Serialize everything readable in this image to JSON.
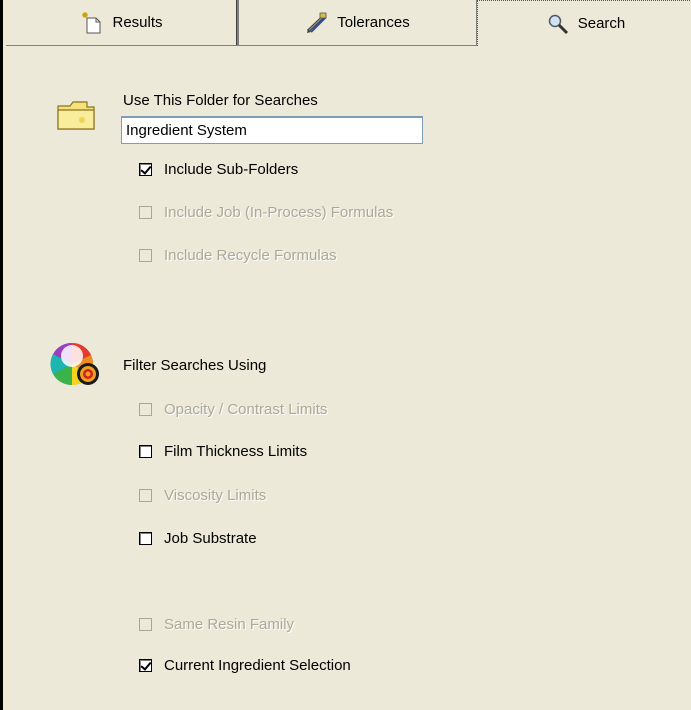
{
  "tabs": [
    {
      "label": "Results",
      "icon": "new-document-icon"
    },
    {
      "label": "Tolerances",
      "icon": "tolerances-icon"
    },
    {
      "label": "Search",
      "icon": "magnifier-icon",
      "active": true
    }
  ],
  "folder_section": {
    "title": "Use This Folder for Searches",
    "icon": "folder-icon",
    "folder_value": "Ingredient System",
    "options": [
      {
        "label": "Include Sub-Folders",
        "checked": true,
        "enabled": true
      },
      {
        "label": "Include Job (In-Process) Formulas",
        "checked": false,
        "enabled": false
      },
      {
        "label": "Include Recycle Formulas",
        "checked": false,
        "enabled": false
      }
    ]
  },
  "filter_section": {
    "title": "Filter Searches Using",
    "icon": "color-wheel-target-icon",
    "options": [
      {
        "label": "Opacity / Contrast Limits",
        "checked": false,
        "enabled": false
      },
      {
        "label": "Film Thickness Limits",
        "checked": false,
        "enabled": true
      },
      {
        "label": "Viscosity Limits",
        "checked": false,
        "enabled": false
      },
      {
        "label": "Job Substrate",
        "checked": false,
        "enabled": true
      },
      {
        "label": "Same Resin Family",
        "checked": false,
        "enabled": false
      },
      {
        "label": "Current Ingredient Selection",
        "checked": true,
        "enabled": true
      }
    ]
  },
  "colors": {
    "background": "#ece9d8",
    "disabled_text": "#aca899",
    "input_border": "#7f9db9"
  }
}
